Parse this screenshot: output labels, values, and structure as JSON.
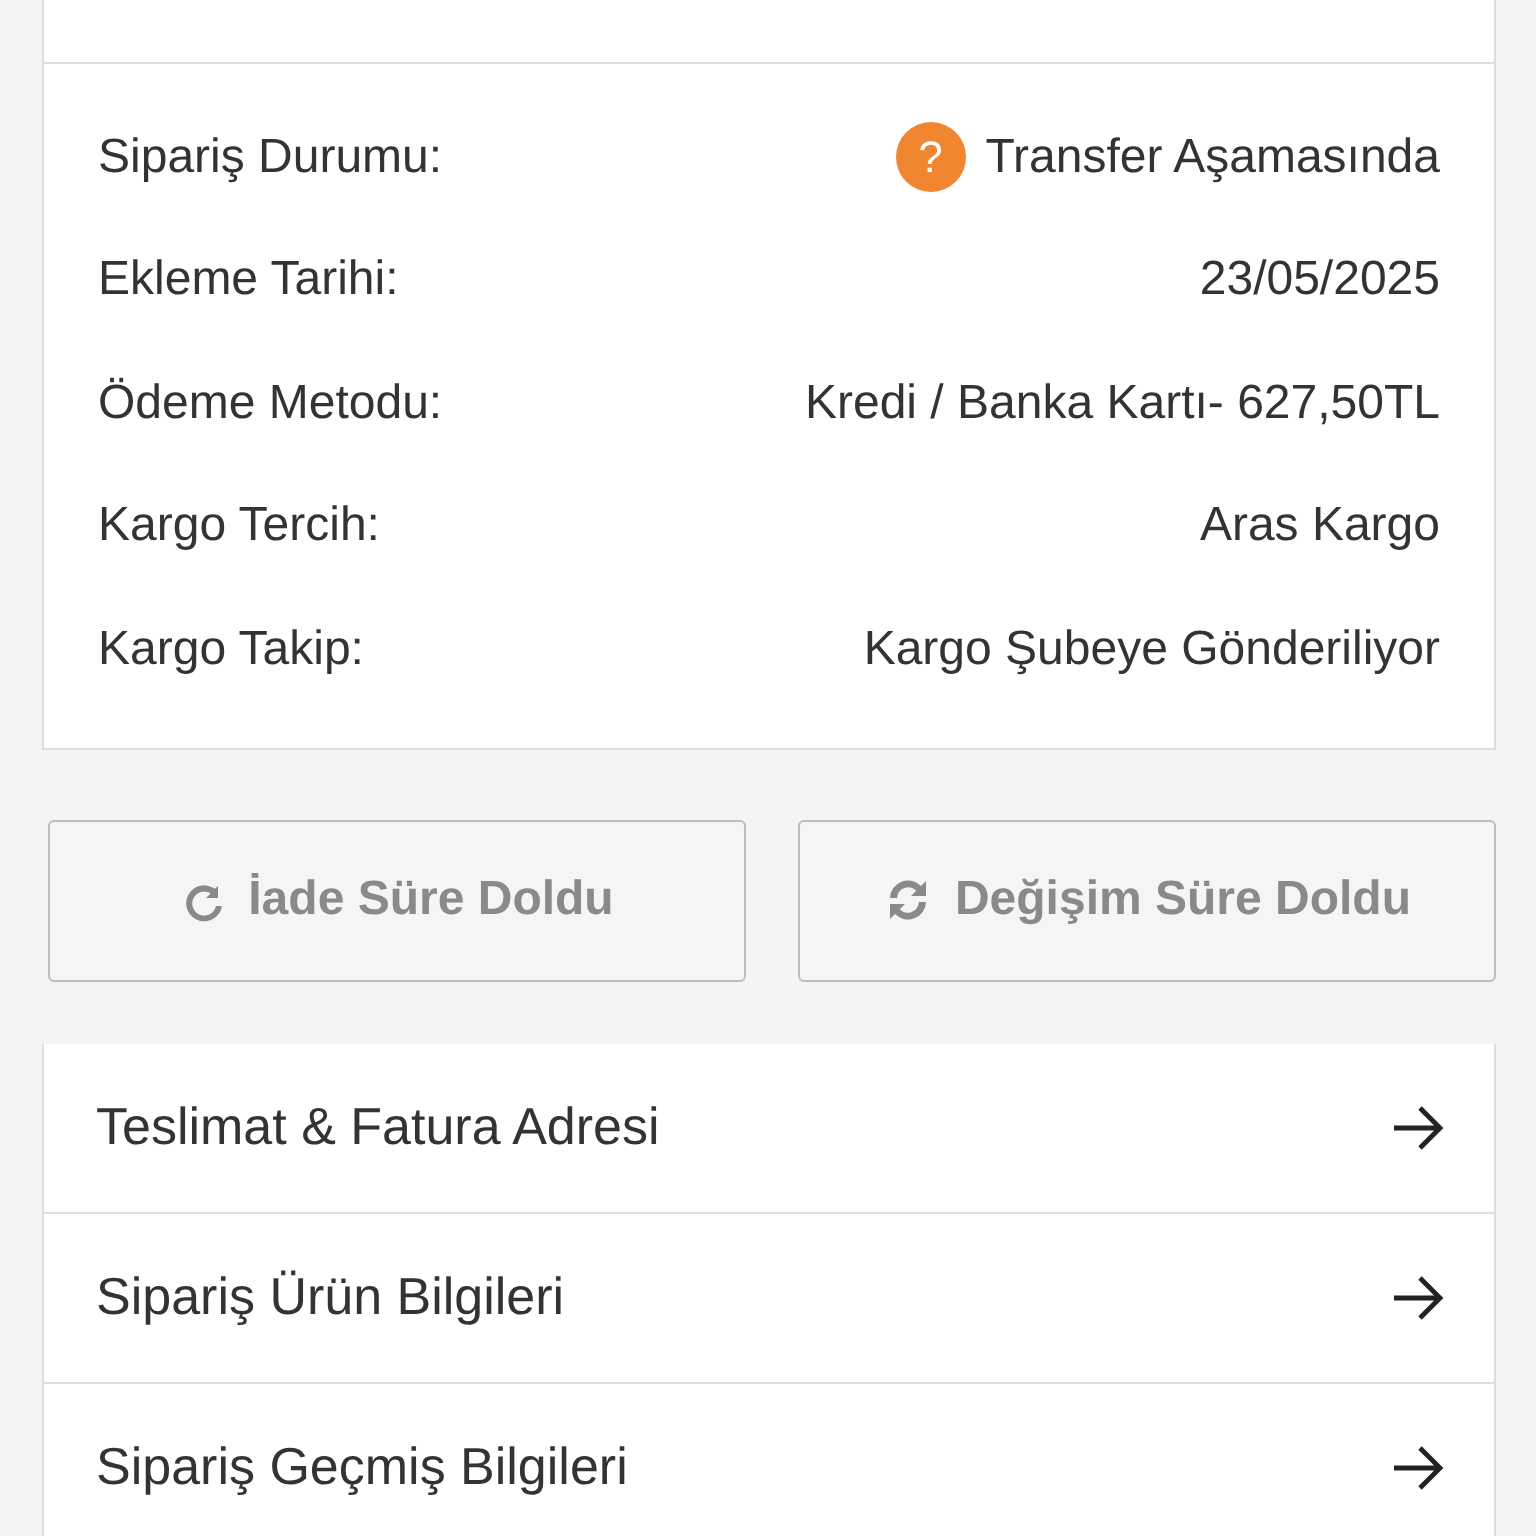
{
  "order_details": [
    {
      "label": "Sipariş Durumu:",
      "value": "Transfer Aşamasında",
      "status_icon": "?"
    },
    {
      "label": "Ekleme Tarihi:",
      "value": "23/05/2025"
    },
    {
      "label": "Ödeme Metodu:",
      "value": "Kredi / Banka Kartı- 627,50TL"
    },
    {
      "label": "Kargo Tercih:",
      "value": "Aras Kargo"
    },
    {
      "label": "Kargo Takip:",
      "value": "Kargo Şubeye Gönderiliyor"
    }
  ],
  "actions": [
    {
      "kind": "return",
      "label": "İade Süre Doldu",
      "disabled": true
    },
    {
      "kind": "exchange",
      "label": "Değişim Süre Doldu",
      "disabled": true
    }
  ],
  "links": [
    {
      "label": "Teslimat & Fatura Adresi"
    },
    {
      "label": "Sipariş Ürün Bilgileri"
    },
    {
      "label": "Sipariş Geçmiş Bilgileri"
    }
  ]
}
